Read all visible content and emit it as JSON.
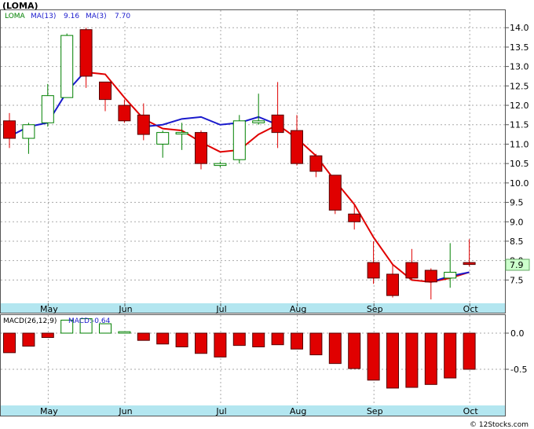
{
  "chart_data": [
    {
      "type": "candlestick",
      "title": "(LOMA)",
      "legend": [
        {
          "label": "LOMA",
          "color": "#008000"
        },
        {
          "label": "MA(13)",
          "value": "9.16",
          "color": "#1a1acc"
        },
        {
          "label": "MA(3)",
          "value": "7.70",
          "color": "#cc0000"
        }
      ],
      "ylim": [
        6.9,
        14.45
      ],
      "yticks": [
        "14.0",
        "13.5",
        "13.0",
        "12.5",
        "12.0",
        "11.5",
        "11.0",
        "10.5",
        "10.0",
        "9.5",
        "9.0",
        "8.5",
        "8.0",
        "7.5"
      ],
      "ytick_values": [
        14.0,
        13.5,
        13.0,
        12.5,
        12.0,
        11.5,
        11.0,
        10.5,
        10.0,
        9.5,
        9.0,
        8.5,
        8.0,
        7.5
      ],
      "last_price_label": "7.9",
      "last_price": 7.9,
      "xlabels": [
        {
          "label": "May",
          "index": 1
        },
        {
          "label": "Jun",
          "index": 5
        },
        {
          "label": "Jul",
          "index": 10
        },
        {
          "label": "Aug",
          "index": 14
        },
        {
          "label": "Sep",
          "index": 18
        },
        {
          "label": "Oct",
          "index": 23
        }
      ],
      "candles": [
        {
          "o": 11.6,
          "h": 11.8,
          "l": 10.9,
          "c": 11.15
        },
        {
          "o": 11.15,
          "h": 11.55,
          "l": 10.75,
          "c": 11.5
        },
        {
          "o": 11.55,
          "h": 12.55,
          "l": 11.45,
          "c": 12.25
        },
        {
          "o": 12.2,
          "h": 13.85,
          "l": 12.2,
          "c": 13.8
        },
        {
          "o": 13.95,
          "h": 14.0,
          "l": 12.45,
          "c": 12.75
        },
        {
          "o": 12.6,
          "h": 12.6,
          "l": 11.85,
          "c": 12.15
        },
        {
          "o": 12.0,
          "h": 12.15,
          "l": 11.55,
          "c": 11.6
        },
        {
          "o": 11.75,
          "h": 12.05,
          "l": 11.1,
          "c": 11.25
        },
        {
          "o": 11.0,
          "h": 11.35,
          "l": 10.65,
          "c": 11.3
        },
        {
          "o": 11.3,
          "h": 11.55,
          "l": 10.85,
          "c": 11.3
        },
        {
          "o": 11.3,
          "h": 11.35,
          "l": 10.35,
          "c": 10.5
        },
        {
          "o": 10.45,
          "h": 10.55,
          "l": 10.4,
          "c": 10.5
        },
        {
          "o": 10.6,
          "h": 11.75,
          "l": 10.5,
          "c": 11.6
        },
        {
          "o": 11.55,
          "h": 12.3,
          "l": 11.5,
          "c": 11.6
        },
        {
          "o": 11.75,
          "h": 12.6,
          "l": 10.9,
          "c": 11.3
        },
        {
          "o": 11.35,
          "h": 11.75,
          "l": 10.45,
          "c": 10.5
        },
        {
          "o": 10.7,
          "h": 10.75,
          "l": 10.15,
          "c": 10.3
        },
        {
          "o": 10.2,
          "h": 10.2,
          "l": 9.2,
          "c": 9.3
        },
        {
          "o": 9.2,
          "h": 9.45,
          "l": 8.8,
          "c": 9.0
        },
        {
          "o": 7.95,
          "h": 8.5,
          "l": 7.4,
          "c": 7.55
        },
        {
          "o": 7.65,
          "h": 7.9,
          "l": 7.05,
          "c": 7.1
        },
        {
          "o": 7.95,
          "h": 8.3,
          "l": 7.5,
          "c": 7.55
        },
        {
          "o": 7.75,
          "h": 7.8,
          "l": 7.0,
          "c": 7.45
        },
        {
          "o": 7.55,
          "h": 8.45,
          "l": 7.3,
          "c": 7.7
        },
        {
          "o": 7.95,
          "h": 8.55,
          "l": 7.85,
          "c": 7.9
        }
      ],
      "ma3": [
        {
          "i": 4,
          "v": 12.85
        },
        {
          "i": 5,
          "v": 12.8
        },
        {
          "i": 6,
          "v": 12.2
        },
        {
          "i": 7,
          "v": 11.65
        },
        {
          "i": 8,
          "v": 11.4
        },
        {
          "i": 9,
          "v": 11.35
        },
        {
          "i": 10,
          "v": 11.05
        },
        {
          "i": 11,
          "v": 10.8
        },
        {
          "i": 12,
          "v": 10.85
        },
        {
          "i": 13,
          "v": 11.25
        },
        {
          "i": 14,
          "v": 11.5
        },
        {
          "i": 15,
          "v": 11.15
        },
        {
          "i": 16,
          "v": 10.7
        },
        {
          "i": 17,
          "v": 10.05
        },
        {
          "i": 18,
          "v": 9.45
        },
        {
          "i": 19,
          "v": 8.6
        },
        {
          "i": 20,
          "v": 7.9
        },
        {
          "i": 21,
          "v": 7.5
        },
        {
          "i": 22,
          "v": 7.45
        },
        {
          "i": 23,
          "v": 7.55
        },
        {
          "i": 24,
          "v": 7.7
        }
      ],
      "ma13": [
        {
          "i": 0,
          "v": 11.1
        },
        {
          "i": 1,
          "v": 11.0
        },
        {
          "i": 2,
          "v": 11.05
        },
        {
          "i": 3,
          "v": 11.25
        },
        {
          "i": 4,
          "v": 11.4
        },
        {
          "i": 5,
          "v": 11.45
        },
        {
          "i": 6,
          "v": 11.5
        },
        {
          "i": 7,
          "v": 11.5
        },
        {
          "i": 8,
          "v": 11.55
        },
        {
          "i": 9,
          "v": 11.65
        },
        {
          "i": 10,
          "v": 11.65
        },
        {
          "i": 11,
          "v": 11.65
        },
        {
          "i": 12,
          "v": 11.65
        },
        {
          "i": 13,
          "v": 11.65
        },
        {
          "i": 14,
          "v": 11.6
        },
        {
          "i": 15,
          "v": 11.3
        },
        {
          "i": 16,
          "v": 11.0
        },
        {
          "i": 17,
          "v": 10.85
        },
        {
          "i": 18,
          "v": 10.4
        },
        {
          "i": 19,
          "v": 10.1
        },
        {
          "i": 20,
          "v": 9.85
        },
        {
          "i": 21,
          "v": 9.55
        },
        {
          "i": 22,
          "v": 9.35
        },
        {
          "i": 23,
          "v": 9.16
        }
      ],
      "ma13_short": [
        {
          "i": 0,
          "v": 11.2
        },
        {
          "i": 1,
          "v": 11.45
        },
        {
          "i": 2,
          "v": 11.55
        },
        {
          "i": 3,
          "v": 12.35
        },
        {
          "i": 4,
          "v": 12.9
        }
      ],
      "ma13_mid": [
        {
          "i": 7,
          "v": 11.45
        },
        {
          "i": 8,
          "v": 11.5
        },
        {
          "i": 9,
          "v": 11.65
        },
        {
          "i": 10,
          "v": 11.7
        },
        {
          "i": 11,
          "v": 11.5
        },
        {
          "i": 12,
          "v": 11.55
        },
        {
          "i": 13,
          "v": 11.7
        },
        {
          "i": 14,
          "v": 11.5
        }
      ],
      "ma13_tail": [
        {
          "i": 22,
          "v": 7.45
        },
        {
          "i": 23,
          "v": 7.6
        },
        {
          "i": 24,
          "v": 7.7
        }
      ],
      "colors": {
        "up": "#008000",
        "down": "#e00000",
        "ma3": "#e00000",
        "ma13": "#1a1acc",
        "axis_band": "#b3e6f0"
      }
    },
    {
      "type": "bar",
      "title": "MACD(26,12,9)",
      "legend": [
        {
          "label": "MACD(26,12,9)",
          "color": "#000000"
        },
        {
          "label": "MACD:-0.64",
          "color": "#1a1acc"
        }
      ],
      "ylim": [
        -1.0,
        0.25
      ],
      "yticks": [
        "0.0",
        "-0.5"
      ],
      "ytick_values": [
        0.0,
        -0.5
      ],
      "values": [
        -0.27,
        -0.18,
        -0.06,
        0.18,
        0.2,
        0.13,
        0.02,
        -0.1,
        -0.15,
        -0.19,
        -0.28,
        -0.33,
        -0.17,
        -0.19,
        -0.16,
        -0.22,
        -0.3,
        -0.42,
        -0.49,
        -0.65,
        -0.76,
        -0.75,
        -0.71,
        -0.62,
        -0.5
      ],
      "xlabels": [
        {
          "label": "May",
          "index": 1
        },
        {
          "label": "Jun",
          "index": 5
        },
        {
          "label": "Jul",
          "index": 10
        },
        {
          "label": "Aug",
          "index": 14
        },
        {
          "label": "Sep",
          "index": 18
        },
        {
          "label": "Oct",
          "index": 23
        }
      ]
    }
  ],
  "footer": {
    "credit": "© 12Stocks.com"
  }
}
